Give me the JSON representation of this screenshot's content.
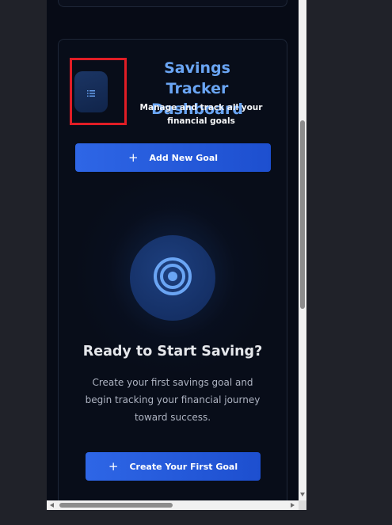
{
  "header": {
    "title": "Savings Tracker Dashboard",
    "subtitle": "Manage and track all your financial goals",
    "icon": "list-icon"
  },
  "actions": {
    "add_goal_label": "Add New Goal",
    "add_goal_icon": "plus-icon"
  },
  "empty_state": {
    "icon": "target-icon",
    "title": "Ready to Start Saving?",
    "description": "Create your first savings goal and begin tracking your financial journey toward success.",
    "cta_label": "Create Your First Goal",
    "cta_icon": "plus-icon"
  },
  "colors": {
    "accent": "#2e66e6",
    "title": "#6aa5f4",
    "background": "#070b16",
    "highlight": "#e11d25"
  }
}
